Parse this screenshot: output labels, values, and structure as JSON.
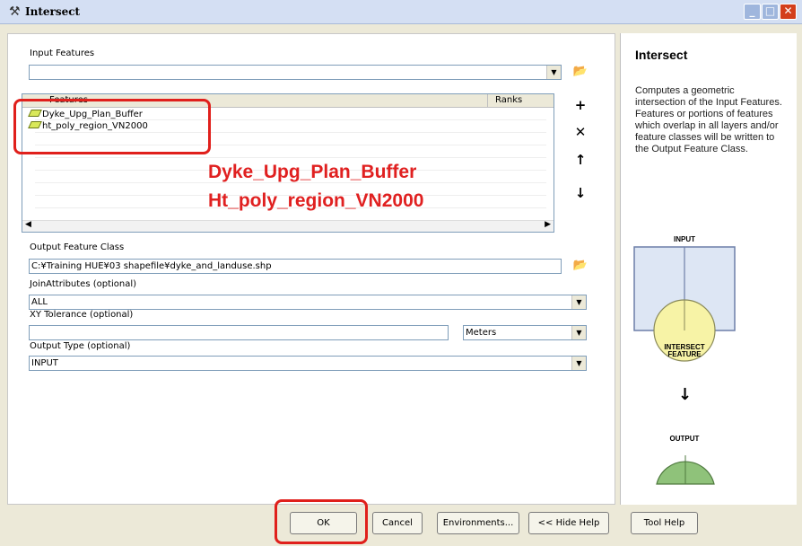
{
  "window": {
    "title": "Intersect"
  },
  "form": {
    "input_features_label": "Input Features",
    "input_features_value": "",
    "table_header": {
      "features": "Features",
      "ranks": "Ranks"
    },
    "features": [
      "Dyke_Upg_Plan_Buffer",
      "ht_poly_region_VN2000"
    ],
    "output_label": "Output Feature Class",
    "output_value": "C:¥Training HUE¥03 shapefile¥dyke_and_landuse.shp",
    "join_label": "JoinAttributes (optional)",
    "join_value": "ALL",
    "xy_label": "XY Tolerance (optional)",
    "xy_value": "",
    "xy_unit": "Meters",
    "output_type_label": "Output Type (optional)",
    "output_type_value": "INPUT"
  },
  "annotation": {
    "line1": "Dyke_Upg_Plan_Buffer",
    "line2": "Ht_poly_region_VN2000"
  },
  "buttons": {
    "ok": "OK",
    "cancel": "Cancel",
    "environments": "Environments...",
    "hide_help": "<< Hide Help",
    "tool_help": "Tool Help"
  },
  "help": {
    "title": "Intersect",
    "body": "Computes a geometric intersection of the Input Features. Features or portions of features which overlap in all layers and/or feature classes will be written to the Output Feature Class.",
    "diagram_input": "INPUT",
    "diagram_intersect": "INTERSECT FEATURE",
    "diagram_output": "OUTPUT"
  },
  "colors": {
    "accent_red": "#e0201c",
    "diagram_yellow": "#f7f3a6",
    "diagram_green": "#8fc27a",
    "diagram_blue": "#dde6f4"
  }
}
